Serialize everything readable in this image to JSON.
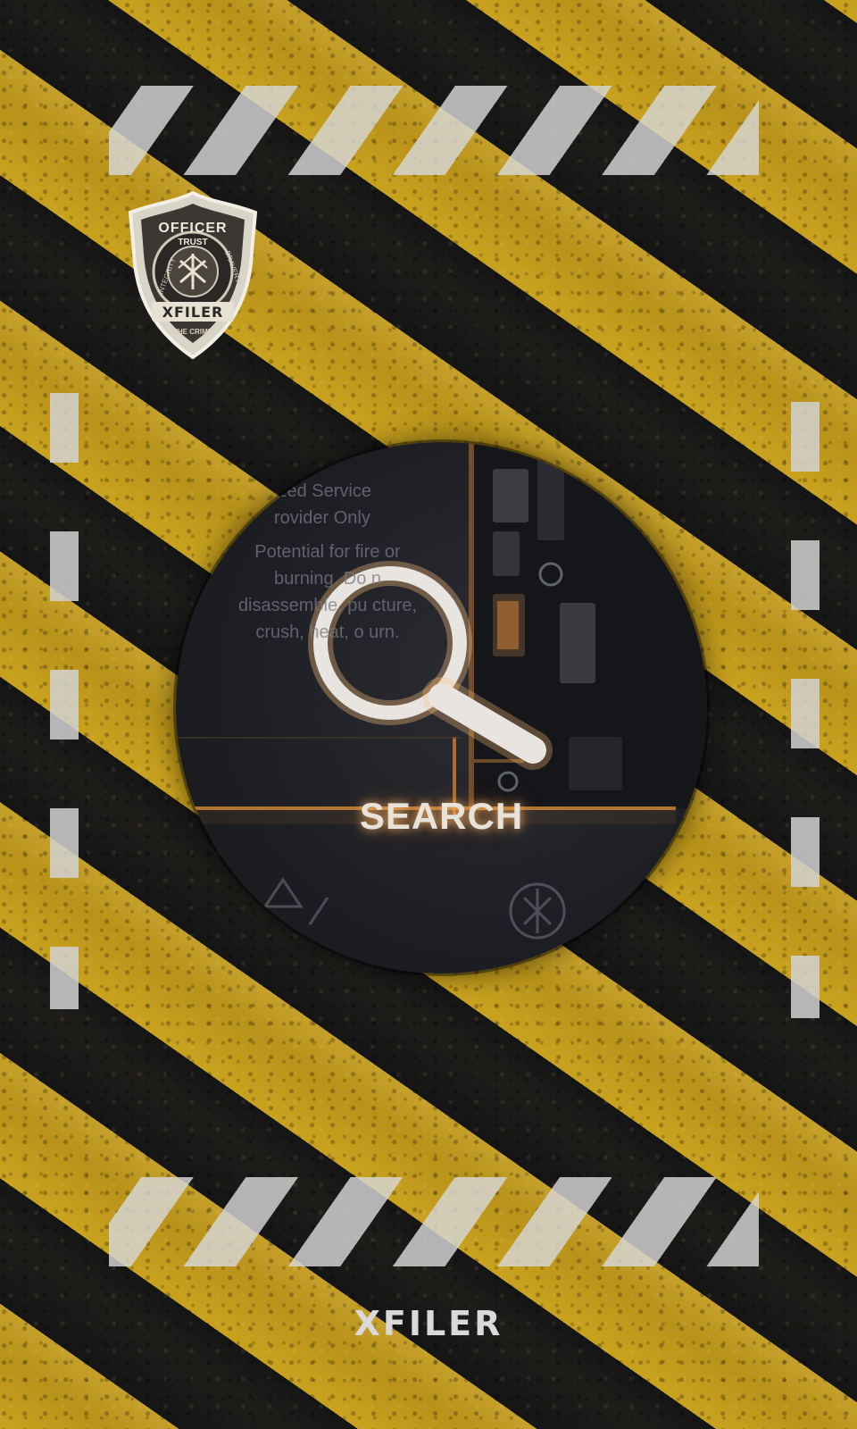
{
  "screen": {
    "colors": {
      "hazard_yellow": "#c9a21f",
      "hazard_black": "#151515",
      "stripe_white": "#d7d7d7",
      "glow": "#ffb766"
    }
  },
  "badge": {
    "icon": "officer-badge-icon",
    "top_text": "OFFICER",
    "ribbon_text": "TRUST",
    "left_text": "INTEGRITY",
    "right_text": "BRAVERY",
    "banner_text": "XFILER",
    "bottom_text": "THE CRIME"
  },
  "search": {
    "icon": "magnifier-icon",
    "label": "SEARCH",
    "background_text": [
      "ized Service",
      "rovider Only",
      "Potential for fire or",
      "burning. Do n",
      "disassemble, pu    cture,",
      "crush, heat, o    urn."
    ]
  },
  "footer": {
    "brand": "XFILER"
  }
}
